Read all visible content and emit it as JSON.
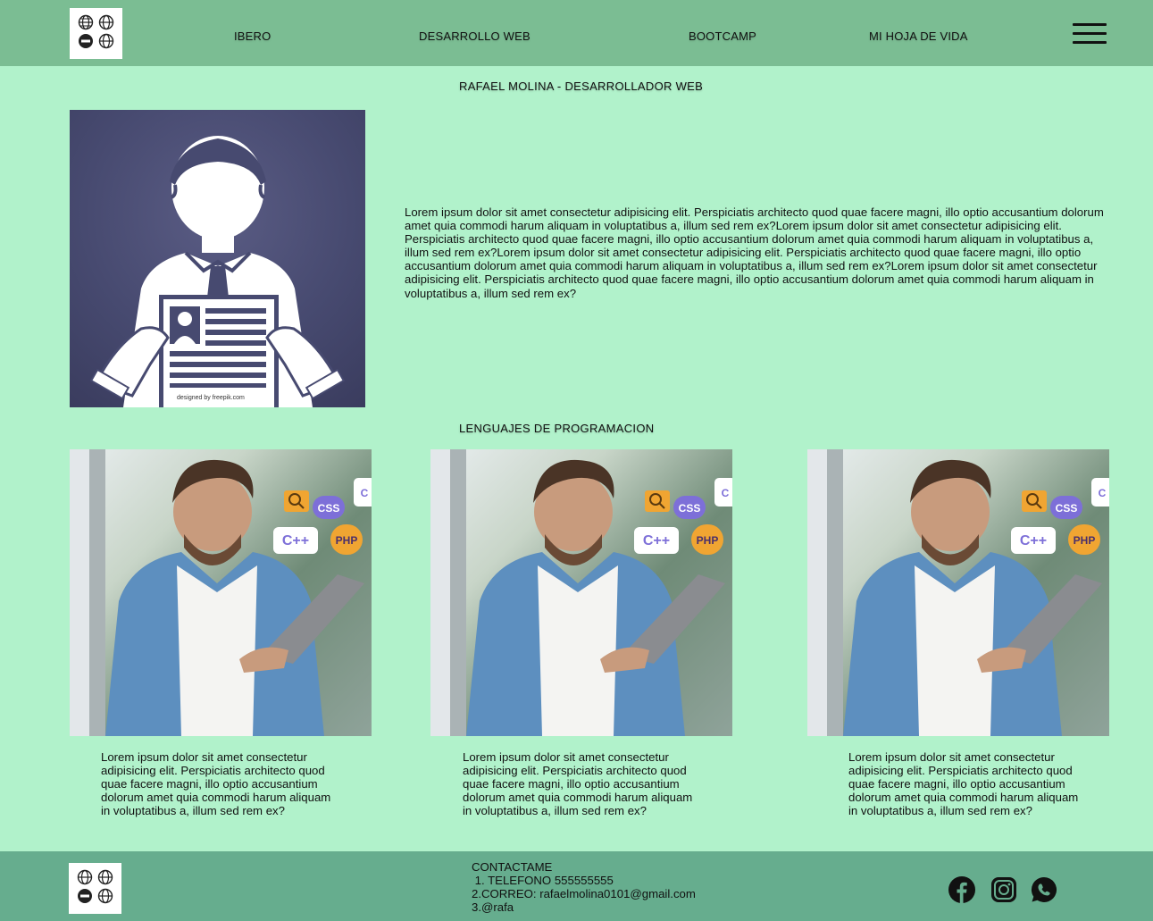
{
  "nav": {
    "items": [
      "IBERO",
      "DESARROLLO WEB",
      "BOOTCAMP",
      "MI HOJA DE VIDA"
    ],
    "logo_icon": "globe-grid-logo",
    "menu_icon": "hamburger-icon"
  },
  "header_title": "RAFAEL MOLINA - DESARROLLADOR WEB",
  "profile": {
    "image_icon": "person-holding-resume",
    "watermark": "designed by freepik.com",
    "bio": "Lorem ipsum dolor sit amet consectetur adipisicing elit. Perspiciatis architecto quod quae facere magni, illo optio accusantium dolorum amet quia commodi harum aliquam in voluptatibus a, illum sed rem ex?Lorem ipsum dolor sit amet consectetur adipisicing elit. Perspiciatis architecto quod quae facere magni, illo optio accusantium dolorum amet quia commodi harum aliquam in voluptatibus a, illum sed rem ex?Lorem ipsum dolor sit amet consectetur adipisicing elit. Perspiciatis architecto quod quae facere magni, illo optio accusantium dolorum amet quia commodi harum aliquam in voluptatibus a, illum sed rem ex?Lorem ipsum dolor sit amet consectetur adipisicing elit. Perspiciatis architecto quod quae facere magni, illo optio accusantium dolorum amet quia commodi harum aliquam in voluptatibus a, illum sed rem ex?"
  },
  "languages": {
    "title": "LENGUAJES DE PROGRAMACION",
    "badges": [
      "CSS",
      "C++",
      "PHP",
      "C"
    ],
    "cards": [
      {
        "text": "Lorem ipsum dolor sit amet consectetur adipisicing elit. Perspiciatis architecto quod quae facere magni, illo optio accusantium dolorum amet quia commodi harum aliquam in voluptatibus a, illum sed rem ex?"
      },
      {
        "text": "Lorem ipsum dolor sit amet consectetur adipisicing elit. Perspiciatis architecto quod quae facere magni, illo optio accusantium dolorum amet quia commodi harum aliquam in voluptatibus a, illum sed rem ex?"
      },
      {
        "text": "Lorem ipsum dolor sit amet consectetur adipisicing elit. Perspiciatis architecto quod quae facere magni, illo optio accusantium dolorum amet quia commodi harum aliquam in voluptatibus a, illum sed rem ex?"
      }
    ]
  },
  "footer": {
    "contact_title": "CONTACTAME",
    "contact_lines": [
      " 1. TELEFONO 555555555",
      "2.CORREO: rafaelmolina0101@gmail.com",
      "3.@rafa"
    ],
    "social_icons": [
      "facebook-icon",
      "instagram-icon",
      "whatsapp-icon"
    ]
  },
  "colors": {
    "header_bg": "#7bbd93",
    "page_bg": "#b1f2cb",
    "footer_bg": "#66ad8e",
    "profile_bg": "#474a70"
  }
}
